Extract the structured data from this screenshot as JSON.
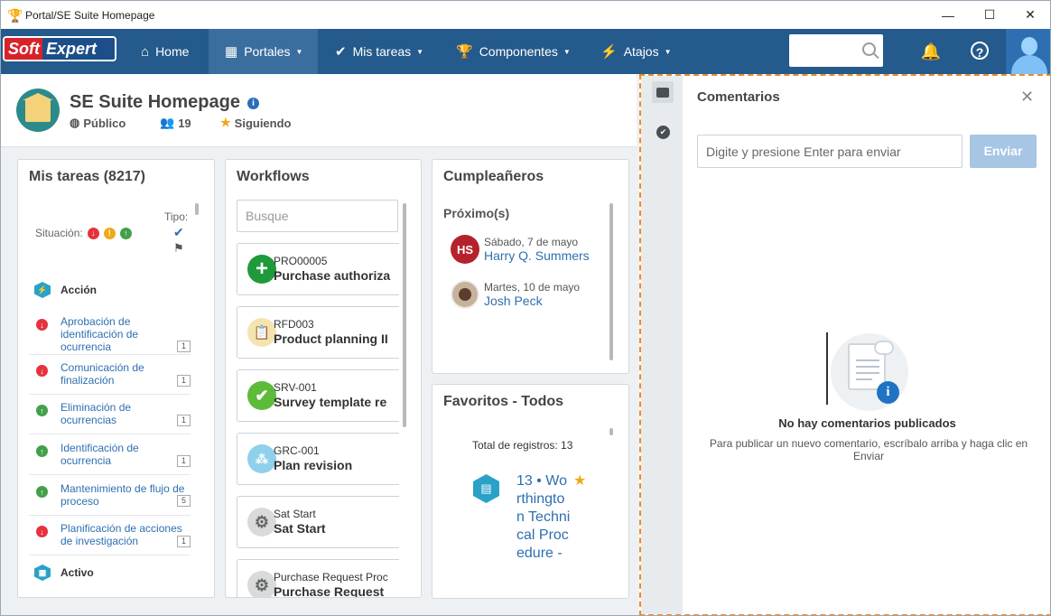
{
  "window": {
    "title": "Portal/SE Suite Homepage",
    "minimize": "—",
    "maximize": "☐",
    "close": "✕"
  },
  "brand": {
    "soft": "Soft",
    "expert": "Expert"
  },
  "nav": {
    "home": "Home",
    "portales": "Portales",
    "tareas": "Mis tareas",
    "componentes": "Componentes",
    "atajos": "Atajos",
    "search_placeholder": ""
  },
  "header": {
    "title": "SE Suite Homepage",
    "visibility": "Público",
    "followers": "19",
    "following": "Siguiendo"
  },
  "tasks": {
    "title": "Mis tareas (8217)",
    "situation_label": "Situación:",
    "type_label": "Tipo:",
    "section_action": "Acción",
    "section_active": "Activo",
    "items": [
      {
        "label": "Aprobación de identificación de ocurrencia",
        "count": "1",
        "status": "red"
      },
      {
        "label": "Comunicación de finalización",
        "count": "1",
        "status": "red"
      },
      {
        "label": "Eliminación de ocurrencias",
        "count": "1",
        "status": "green"
      },
      {
        "label": "Identificación de ocurrencia",
        "count": "1",
        "status": "green"
      },
      {
        "label": "Mantenimiento de flujo de proceso",
        "count": "5",
        "status": "green"
      },
      {
        "label": "Planificación de acciones de investigación",
        "count": "1",
        "status": "red"
      }
    ]
  },
  "workflows": {
    "title": "Workflows",
    "search_placeholder": "Busque",
    "items": [
      {
        "code": "PRO00005",
        "name": "Purchase authoriza",
        "color": "#1e9a3a"
      },
      {
        "code": "RFD003",
        "name": "Product planning II",
        "color": "#f3e4b0"
      },
      {
        "code": "SRV-001",
        "name": "Survey template re",
        "color": "#5dbb3a"
      },
      {
        "code": "GRC-001",
        "name": "Plan revision",
        "color": "#8fd0ea"
      },
      {
        "code": "Sat Start",
        "name": "Sat Start",
        "color": "#d9dadb"
      },
      {
        "code": "Purchase Request Proc",
        "name": "Purchase Request",
        "color": "#d9dadb"
      }
    ]
  },
  "birthdays": {
    "title": "Cumpleañeros",
    "subtitle": "Próximo(s)",
    "people": [
      {
        "initials": "HS",
        "date": "Sábado, 7 de mayo",
        "name": "Harry Q. Summers"
      },
      {
        "initials": "",
        "date": "Martes, 10 de mayo",
        "name": "Josh Peck"
      }
    ]
  },
  "favorites": {
    "title": "Favoritos - Todos",
    "total": "Total de registros: 13",
    "item": "13 • Worthington Technical Procedure -"
  },
  "comments": {
    "title": "Comentarios",
    "input_placeholder": "Digite y presione Enter para enviar",
    "send": "Enviar",
    "empty_title": "No hay comentarios publicados",
    "empty_sub": "Para publicar un nuevo comentario, escríbalo arriba y haga clic en Enviar"
  }
}
